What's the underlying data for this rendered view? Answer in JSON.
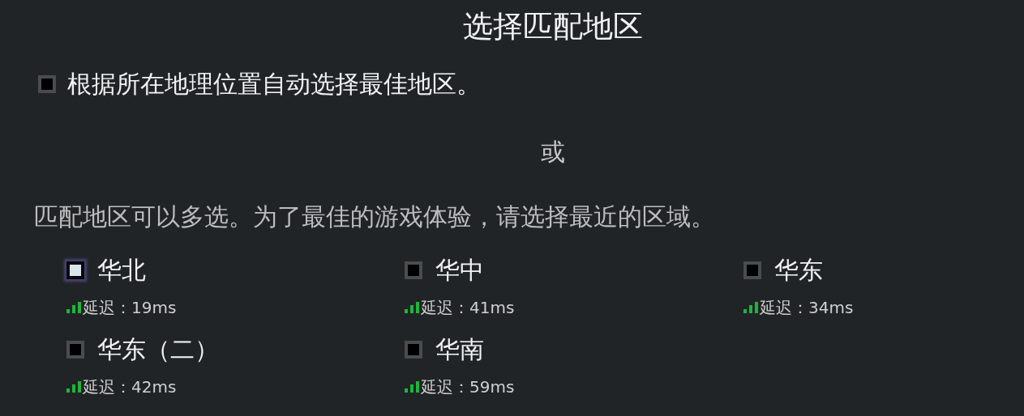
{
  "title": "选择匹配地区",
  "auto_select": {
    "label": "根据所在地理位置自动选择最佳地区。",
    "checked": false
  },
  "separator": "或",
  "description": "匹配地区可以多选。为了最佳的游戏体验，请选择最近的区域。",
  "regions": [
    {
      "name": "华北",
      "latency": "延迟：19ms",
      "checked": false,
      "highlighted": true
    },
    {
      "name": "华中",
      "latency": "延迟：41ms",
      "checked": false,
      "highlighted": false
    },
    {
      "name": "华东",
      "latency": "延迟：34ms",
      "checked": false,
      "highlighted": false
    },
    {
      "name": "华东（二）",
      "latency": "延迟：42ms",
      "checked": false,
      "highlighted": false
    },
    {
      "name": "华南",
      "latency": "延迟：59ms",
      "checked": false,
      "highlighted": false
    }
  ]
}
